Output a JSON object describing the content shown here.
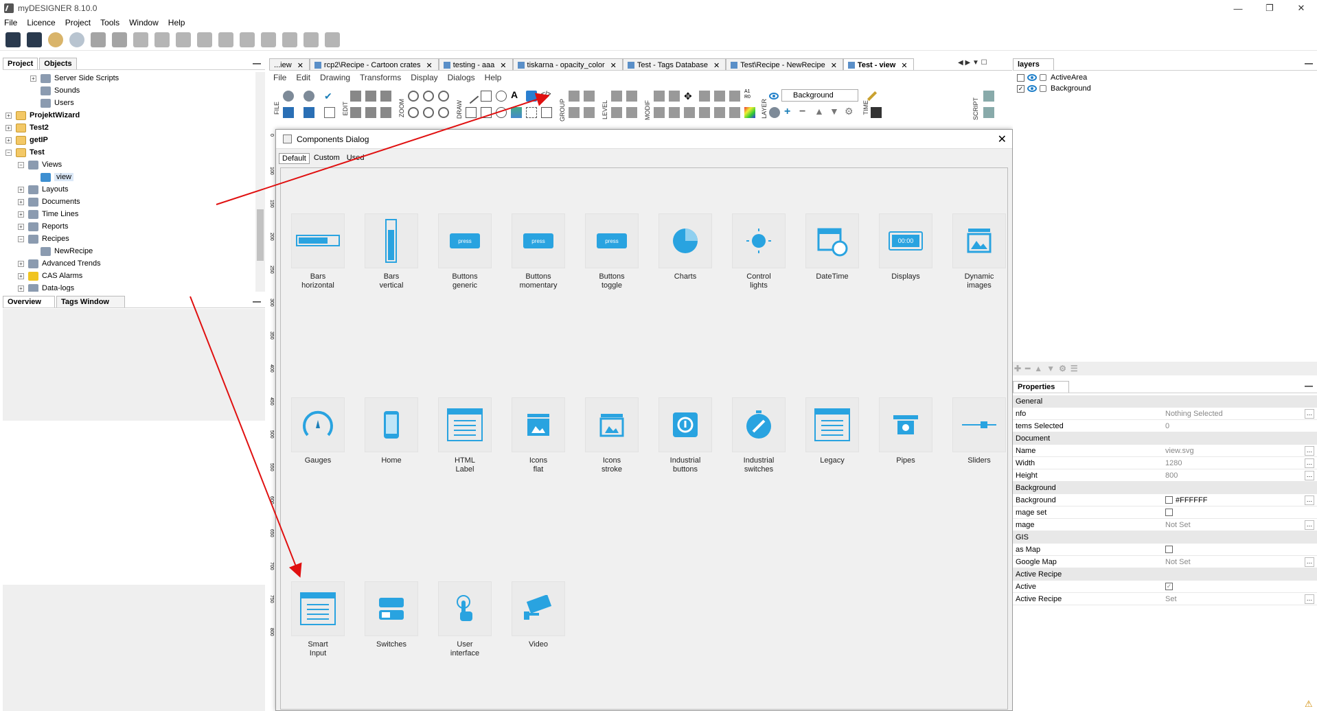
{
  "window": {
    "title": "myDESIGNER 8.10.0"
  },
  "menu": [
    "File",
    "Licence",
    "Project",
    "Tools",
    "Window",
    "Help"
  ],
  "left_panel": {
    "tabs": [
      "Project",
      "Objects"
    ],
    "tree": [
      {
        "label": "Server Side Scripts",
        "level": 2,
        "bold": false
      },
      {
        "label": "Sounds",
        "level": 2,
        "bold": false
      },
      {
        "label": "Users",
        "level": 2,
        "bold": false
      },
      {
        "label": "ProjektWizard",
        "level": 0,
        "bold": true
      },
      {
        "label": "Test2",
        "level": 0,
        "bold": true
      },
      {
        "label": "getIP",
        "level": 0,
        "bold": true
      },
      {
        "label": "Test",
        "level": 0,
        "bold": true
      },
      {
        "label": "Views",
        "level": 1,
        "bold": false
      },
      {
        "label": "view",
        "level": 2,
        "bold": false
      },
      {
        "label": "Layouts",
        "level": 1,
        "bold": false
      },
      {
        "label": "Documents",
        "level": 1,
        "bold": false
      },
      {
        "label": "Time Lines",
        "level": 1,
        "bold": false
      },
      {
        "label": "Reports",
        "level": 1,
        "bold": false
      },
      {
        "label": "Recipes",
        "level": 1,
        "bold": false
      },
      {
        "label": "NewRecipe",
        "level": 2,
        "bold": false
      },
      {
        "label": "Advanced Trends",
        "level": 1,
        "bold": false
      },
      {
        "label": "CAS Alarms",
        "level": 1,
        "bold": false
      },
      {
        "label": "Data-logs",
        "level": 1,
        "bold": false
      }
    ],
    "bottom_tabs": [
      "Overview",
      "Tags Window"
    ]
  },
  "doc_tabs": [
    {
      "label": "...iew",
      "active": false
    },
    {
      "label": "rcp2\\Recipe - Cartoon crates",
      "active": false
    },
    {
      "label": "testing - aaa",
      "active": false
    },
    {
      "label": "tiskarna - opacity_color",
      "active": false
    },
    {
      "label": "Test - Tags Database",
      "active": false
    },
    {
      "label": "Test\\Recipe - NewRecipe",
      "active": false
    },
    {
      "label": "Test - view",
      "active": true
    }
  ],
  "inner_menu": [
    "File",
    "Edit",
    "Drawing",
    "Transforms",
    "Display",
    "Dialogs",
    "Help"
  ],
  "inner_toolbar": {
    "groups": [
      "FILE",
      "EDIT",
      "ZOOM",
      "DRAW",
      "GROUP",
      "LEVEL",
      "MODIF",
      "LAYER",
      "TIME",
      "SCRIPT"
    ],
    "layer_select": "Background",
    "a1r0": "A1\nR0"
  },
  "ruler": [
    "0",
    "100",
    "150",
    "200",
    "250",
    "300",
    "350",
    "400",
    "450",
    "500",
    "550",
    "600",
    "650",
    "700",
    "750",
    "800"
  ],
  "dialog": {
    "title": "Components Dialog",
    "tabs": [
      "Default",
      "Custom",
      "Used"
    ],
    "press_label": "press",
    "display_label": "00:00",
    "components": [
      {
        "line1": "Bars",
        "line2": "horizontal",
        "icon": "bars-horizontal-icon"
      },
      {
        "line1": "Bars",
        "line2": "vertical",
        "icon": "bars-vertical-icon"
      },
      {
        "line1": "Buttons",
        "line2": "generic",
        "icon": "buttons-generic-icon"
      },
      {
        "line1": "Buttons",
        "line2": "momentary",
        "icon": "buttons-momentary-icon"
      },
      {
        "line1": "Buttons",
        "line2": "toggle",
        "icon": "buttons-toggle-icon"
      },
      {
        "line1": "Charts",
        "line2": "",
        "icon": "pie-chart-icon"
      },
      {
        "line1": "Control",
        "line2": "lights",
        "icon": "control-light-icon"
      },
      {
        "line1": "DateTime",
        "line2": "",
        "icon": "calendar-clock-icon"
      },
      {
        "line1": "Displays",
        "line2": "",
        "icon": "display-icon"
      },
      {
        "line1": "Dynamic",
        "line2": "images",
        "icon": "dynamic-image-icon"
      },
      {
        "line1": "Gauges",
        "line2": "",
        "icon": "gauge-icon"
      },
      {
        "line1": "Home",
        "line2": "",
        "icon": "phone-icon"
      },
      {
        "line1": "HTML",
        "line2": "Label",
        "icon": "html-label-icon"
      },
      {
        "line1": "Icons",
        "line2": "flat",
        "icon": "icons-flat-icon"
      },
      {
        "line1": "Icons",
        "line2": "stroke",
        "icon": "icons-stroke-icon"
      },
      {
        "line1": "Industrial",
        "line2": "buttons",
        "icon": "industrial-button-icon"
      },
      {
        "line1": "Industrial",
        "line2": "switches",
        "icon": "industrial-switch-icon"
      },
      {
        "line1": "Legacy",
        "line2": "",
        "icon": "legacy-icon"
      },
      {
        "line1": "Pipes",
        "line2": "",
        "icon": "pipes-icon"
      },
      {
        "line1": "Sliders",
        "line2": "",
        "icon": "slider-icon"
      },
      {
        "line1": "Smart",
        "line2": "Input",
        "icon": "smart-input-icon"
      },
      {
        "line1": "Switches",
        "line2": "",
        "icon": "switches-icon"
      },
      {
        "line1": "User",
        "line2": "interface",
        "icon": "touch-icon"
      },
      {
        "line1": "Video",
        "line2": "",
        "icon": "camera-icon"
      }
    ]
  },
  "layers_panel": {
    "title": "layers",
    "layers": [
      {
        "name": "ActiveArea",
        "checked": false
      },
      {
        "name": "Background",
        "checked": true
      }
    ]
  },
  "properties": {
    "title": "Properties",
    "rows": [
      {
        "section": true,
        "key": "General"
      },
      {
        "key": "nfo",
        "value": "Nothing Selected",
        "edit": true
      },
      {
        "key": "tems Selected",
        "value": "0"
      },
      {
        "section": true,
        "key": "Document"
      },
      {
        "key": "Name",
        "value": "view.svg",
        "edit": true
      },
      {
        "key": "Width",
        "value": "1280",
        "edit": true
      },
      {
        "key": "Height",
        "value": "800",
        "edit": true
      },
      {
        "section": true,
        "key": "Background"
      },
      {
        "key": "Background",
        "value": "#FFFFFF",
        "swatch": true,
        "edit": true
      },
      {
        "key": "mage set",
        "value": "",
        "checkbox": true
      },
      {
        "key": "mage",
        "value": "Not Set",
        "edit": true
      },
      {
        "section": true,
        "key": "GIS"
      },
      {
        "key": "as Map",
        "value": "",
        "checkbox": true
      },
      {
        "key": "Google Map",
        "value": "Not Set",
        "edit": true
      },
      {
        "section": true,
        "key": "Active Recipe"
      },
      {
        "key": "Active",
        "value": "",
        "checkbox": true,
        "checked": true
      },
      {
        "key": "Active Recipe",
        "value": "Set",
        "edit": true
      }
    ]
  },
  "colors": {
    "accent": "#29a3e0",
    "accent_dark": "#1c7fb8",
    "arrow": "#e01010"
  }
}
